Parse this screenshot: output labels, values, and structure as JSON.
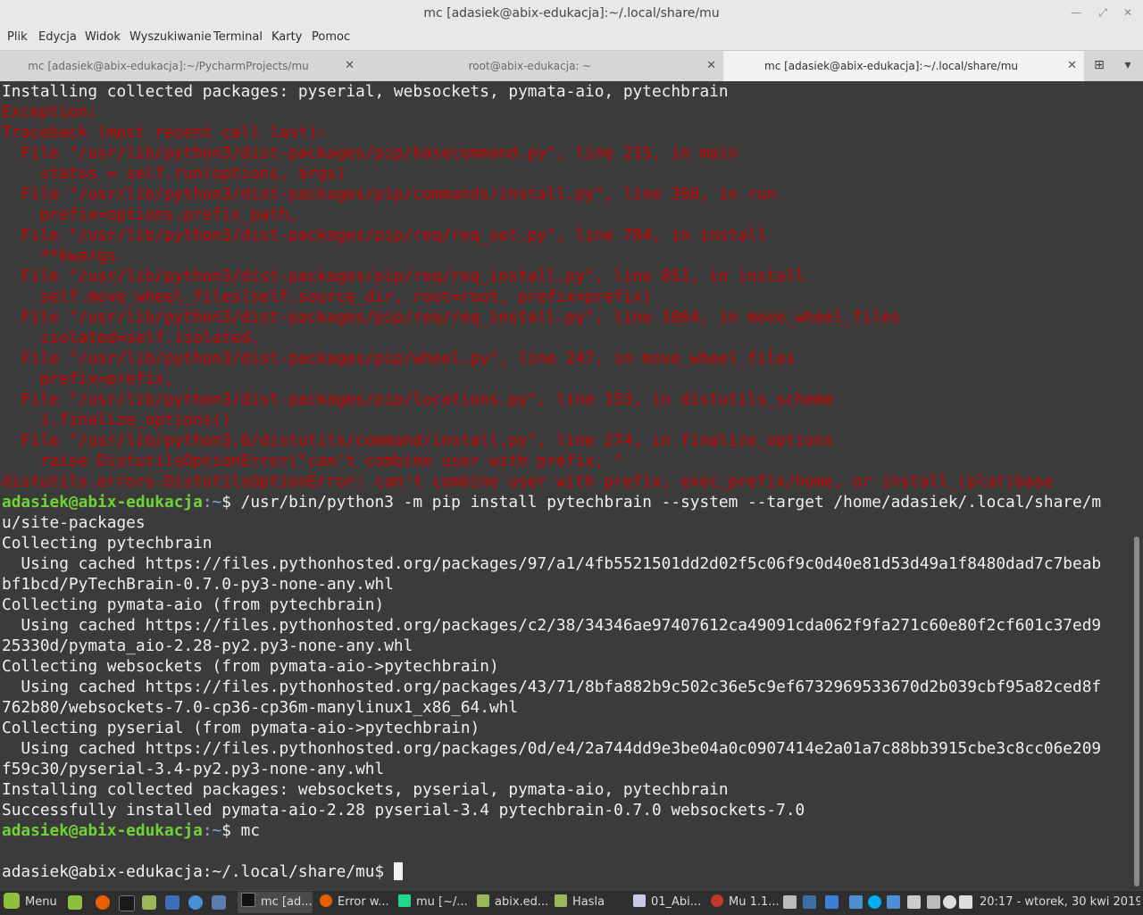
{
  "window": {
    "title": "mc [adasiek@abix-edukacja]:~/.local/share/mu",
    "controls": [
      "minimize-icon",
      "restore-icon",
      "close-icon"
    ]
  },
  "menu": [
    "Plik",
    "Edycja",
    "Widok",
    "Wyszukiwanie",
    "Terminal",
    "Karty",
    "Pomoc"
  ],
  "tabs": [
    {
      "label": "mc [adasiek@abix-edukacja]:~/PycharmProjects/mu",
      "close": "✕",
      "active": false
    },
    {
      "label": "root@abix-edukacja: ~",
      "close": "✕",
      "active": false
    },
    {
      "label": "mc [adasiek@abix-edukacja]:~/.local/share/mu",
      "close": "✕",
      "active": true
    }
  ],
  "tab_buttons": {
    "new_tab": "⊞",
    "tab_list": "▾"
  },
  "terminal": {
    "lines": [
      {
        "type": "out",
        "text": "Installing collected packages: pyserial, websockets, pymata-aio, pytechbrain"
      },
      {
        "type": "err",
        "text": "Exception:"
      },
      {
        "type": "err",
        "text": "Traceback (most recent call last):"
      },
      {
        "type": "err",
        "text": "  File \"/usr/lib/python3/dist-packages/pip/basecommand.py\", line 215, in main"
      },
      {
        "type": "err",
        "text": "    status = self.run(options, args)"
      },
      {
        "type": "err",
        "text": "  File \"/usr/lib/python3/dist-packages/pip/commands/install.py\", line 360, in run"
      },
      {
        "type": "err",
        "text": "    prefix=options.prefix_path,"
      },
      {
        "type": "err",
        "text": "  File \"/usr/lib/python3/dist-packages/pip/req/req_set.py\", line 784, in install"
      },
      {
        "type": "err",
        "text": "    **kwargs"
      },
      {
        "type": "err",
        "text": "  File \"/usr/lib/python3/dist-packages/pip/req/req_install.py\", line 851, in install"
      },
      {
        "type": "err",
        "text": "    self.move_wheel_files(self.source_dir, root=root, prefix=prefix)"
      },
      {
        "type": "err",
        "text": "  File \"/usr/lib/python3/dist-packages/pip/req/req_install.py\", line 1064, in move_wheel_files"
      },
      {
        "type": "err",
        "text": "    isolated=self.isolated,"
      },
      {
        "type": "err",
        "text": "  File \"/usr/lib/python3/dist-packages/pip/wheel.py\", line 247, in move_wheel_files"
      },
      {
        "type": "err",
        "text": "    prefix=prefix,"
      },
      {
        "type": "err",
        "text": "  File \"/usr/lib/python3/dist-packages/pip/locations.py\", line 153, in distutils_scheme"
      },
      {
        "type": "err",
        "text": "    i.finalize_options()"
      },
      {
        "type": "err",
        "text": "  File \"/usr/lib/python3.6/distutils/command/install.py\", line 274, in finalize_options"
      },
      {
        "type": "err",
        "text": "    raise DistutilsOptionError(\"can't combine user with prefix, \""
      },
      {
        "type": "err",
        "text": "distutils.errors.DistutilsOptionError: can't combine user with prefix, exec_prefix/home, or install_(plat)base"
      },
      {
        "type": "prompt",
        "user": "adasiek@abix-edukacja",
        "path": ":~",
        "cmd": "$ /usr/bin/python3 -m pip install pytechbrain --system --target /home/adasiek/.local/share/m"
      },
      {
        "type": "out",
        "text": "u/site-packages"
      },
      {
        "type": "out",
        "text": "Collecting pytechbrain"
      },
      {
        "type": "out",
        "text": "  Using cached https://files.pythonhosted.org/packages/97/a1/4fb5521501dd2d02f5c06f9c0d40e81d53d49a1f8480dad7c7beab"
      },
      {
        "type": "out",
        "text": "bf1bcd/PyTechBrain-0.7.0-py3-none-any.whl"
      },
      {
        "type": "out",
        "text": "Collecting pymata-aio (from pytechbrain)"
      },
      {
        "type": "out",
        "text": "  Using cached https://files.pythonhosted.org/packages/c2/38/34346ae97407612ca49091cda062f9fa271c60e80f2cf601c37ed9"
      },
      {
        "type": "out",
        "text": "25330d/pymata_aio-2.28-py2.py3-none-any.whl"
      },
      {
        "type": "out",
        "text": "Collecting websockets (from pymata-aio->pytechbrain)"
      },
      {
        "type": "out",
        "text": "  Using cached https://files.pythonhosted.org/packages/43/71/8bfa882b9c502c36e5c9ef6732969533670d2b039cbf95a82ced8f"
      },
      {
        "type": "out",
        "text": "762b80/websockets-7.0-cp36-cp36m-manylinux1_x86_64.whl"
      },
      {
        "type": "out",
        "text": "Collecting pyserial (from pymata-aio->pytechbrain)"
      },
      {
        "type": "out",
        "text": "  Using cached https://files.pythonhosted.org/packages/0d/e4/2a744dd9e3be04a0c0907414e2a01a7c88bb3915cbe3c8cc06e209"
      },
      {
        "type": "out",
        "text": "f59c30/pyserial-3.4-py2.py3-none-any.whl"
      },
      {
        "type": "out",
        "text": "Installing collected packages: websockets, pyserial, pymata-aio, pytechbrain"
      },
      {
        "type": "out",
        "text": "Successfully installed pymata-aio-2.28 pyserial-3.4 pytechbrain-0.7.0 websockets-7.0"
      },
      {
        "type": "prompt",
        "user": "adasiek@abix-edukacja",
        "path": ":~",
        "cmd": "$ mc"
      },
      {
        "type": "out",
        "text": ""
      },
      {
        "type": "out",
        "text": "adasiek@abix-edukacja:~/.local/share/mu$ ",
        "cursor": true
      }
    ]
  },
  "panel": {
    "menu_label": "Menu",
    "launchers": [
      "show-desktop-icon",
      "firefox-icon",
      "terminal-icon",
      "files-icon",
      "mail-icon",
      "chromium-icon",
      "editor-icon"
    ],
    "tasks": [
      {
        "label": "mc [ad...",
        "icon": "terminal-icon",
        "active": true
      },
      {
        "label": "Error w...",
        "icon": "firefox-icon",
        "active": false
      },
      {
        "label": "mu [~/...",
        "icon": "pycharm-icon",
        "active": false
      },
      {
        "label": "abix.ed...",
        "icon": "folder-icon",
        "active": false
      },
      {
        "label": "Hasla",
        "icon": "folder-icon",
        "active": false
      },
      {
        "label": "01_Abi...",
        "icon": "document-icon",
        "active": false
      },
      {
        "label": "Mu 1.1...",
        "icon": "mu-icon",
        "active": false
      }
    ],
    "tray": [
      "keyboard-icon",
      "shield-icon",
      "bluetooth-icon",
      "network-icon",
      "skype-icon",
      "dropbox-icon",
      "p-icon",
      "updates-icon",
      "user-icon",
      "volume-icon",
      "network-wired-icon"
    ],
    "clock": "20:17 - wtorek, 30 kwi 2019",
    "colors": {
      "panel": "#2f2f2f",
      "mint_green": "#8fbf3f"
    }
  },
  "colors": {
    "terminal_bg": "#3b3b3b",
    "terminal_fg": "#f0f0f0",
    "error": "#cc0000",
    "prompt_user": "#6fd336",
    "prompt_path": "#8aa9d8"
  }
}
